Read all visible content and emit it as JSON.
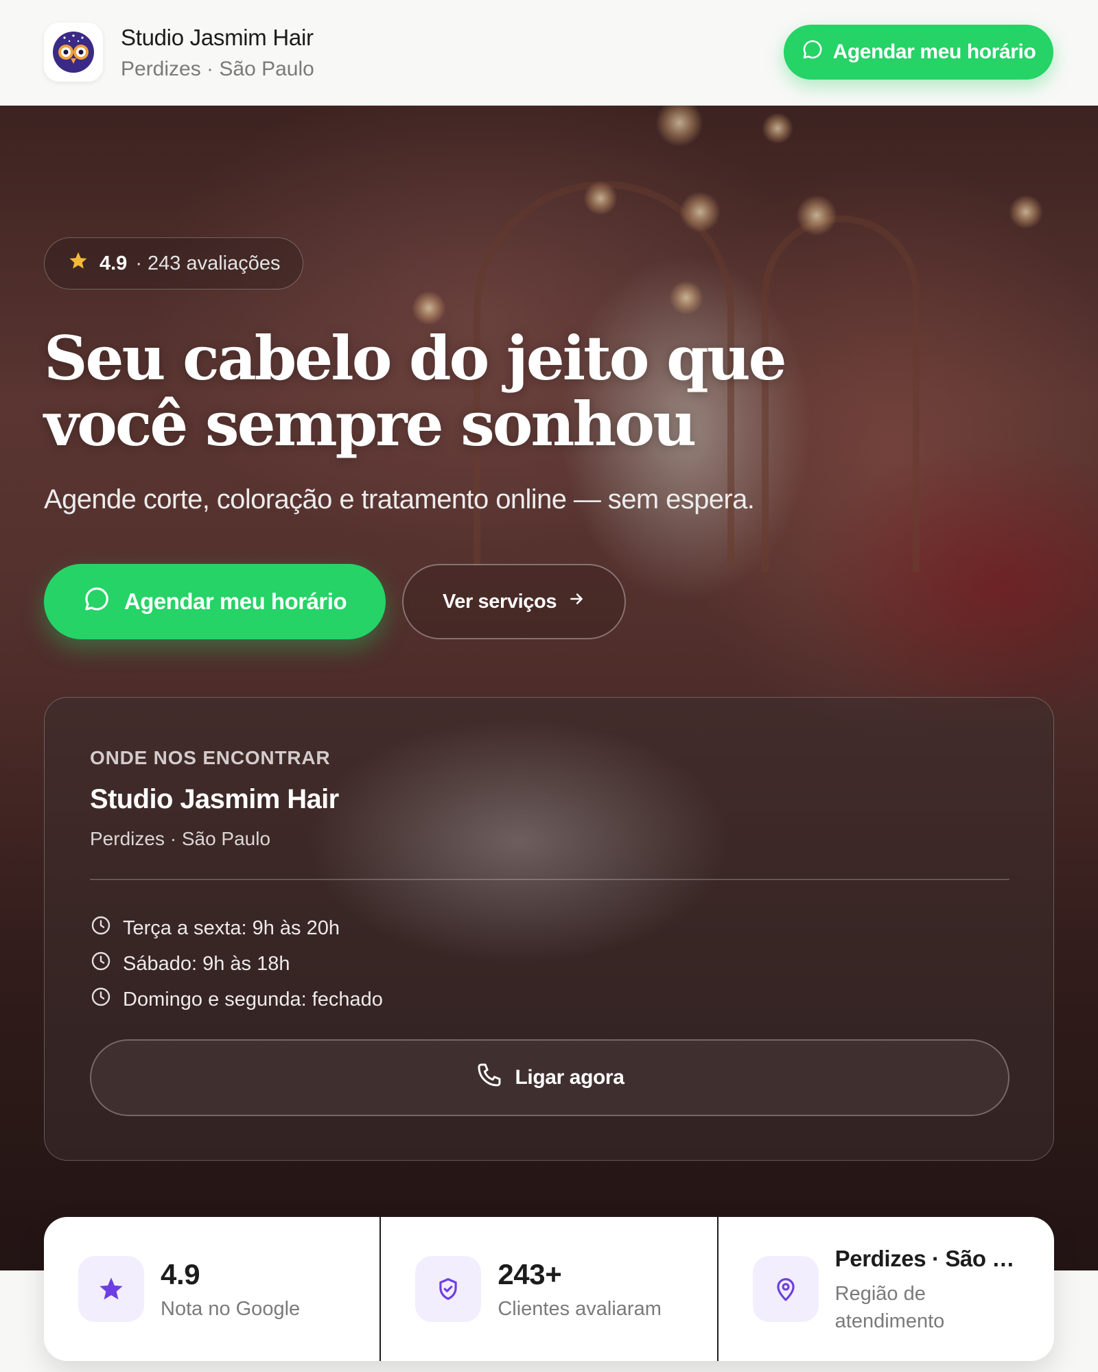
{
  "header": {
    "brand_name": "Studio Jasmim Hair",
    "brand_location": "Perdizes · São Paulo",
    "cta_label": "Agendar meu horário",
    "logo_icon": "owl-logo-icon"
  },
  "hero": {
    "rating_score": "4.9",
    "rating_count": "· 243 avaliações",
    "title_line1": "Seu cabelo do jeito que",
    "title_line2": "você sempre sonhou",
    "subtitle": "Agende corte, coloração e tratamento online — sem espera.",
    "primary_cta": "Agendar meu horário",
    "secondary_cta": "Ver serviços"
  },
  "location_card": {
    "eyebrow": "ONDE NOS ENCONTRAR",
    "name": "Studio Jasmim Hair",
    "area": "Perdizes · São Paulo",
    "hours": [
      "Terça a sexta: 9h às 20h",
      "Sábado: 9h às 18h",
      "Domingo e segunda: fechado"
    ],
    "call_label": "Ligar agora"
  },
  "stats": [
    {
      "icon": "star-icon",
      "value": "4.9",
      "label": "Nota no Google"
    },
    {
      "icon": "shield-check-icon",
      "value": "243+",
      "label": "Clientes avaliaram"
    },
    {
      "icon": "map-pin-icon",
      "value": "Perdizes · São Paulo",
      "label": "Região de atendimento"
    }
  ],
  "colors": {
    "whatsapp_green": "#25d366",
    "accent_purple": "#6d3fe0",
    "stat_icon_bg": "#f2eefe",
    "star_yellow": "#f5b93a"
  }
}
